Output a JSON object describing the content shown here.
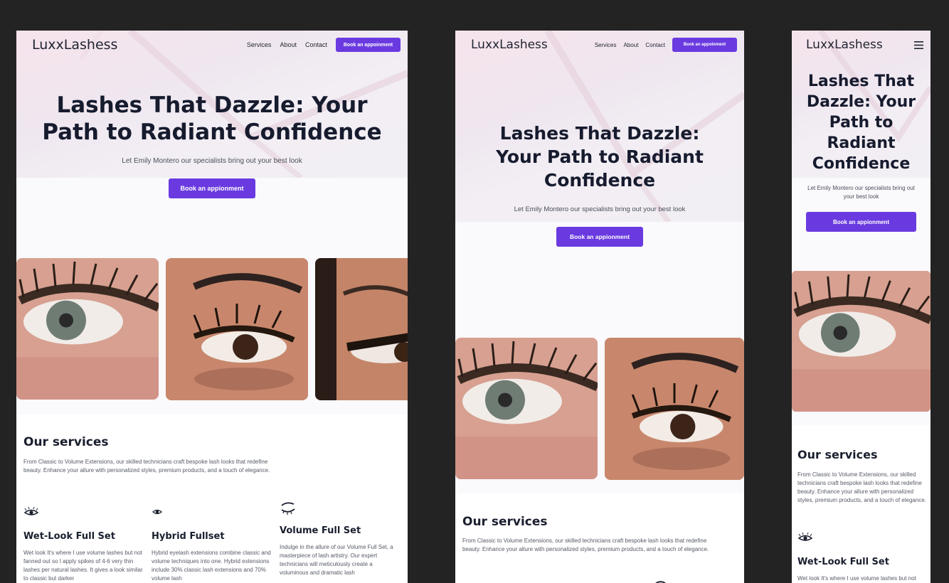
{
  "brand": "LuxxLashess",
  "nav": {
    "services": "Services",
    "about": "About",
    "contact": "Contact",
    "cta": "Book an appoinment"
  },
  "hero": {
    "title": "Lashes That Dazzle: Your Path to Radiant Confidence",
    "subtitle": "Let Emily Montero  our specialists bring out your best look",
    "cta": "Book an appionment"
  },
  "services": {
    "title": "Our services",
    "desc": "From Classic to Volume Extensions, our skilled technicians craft bespoke lash looks that redefine beauty. Enhance your allure with personalized styles, premium products, and a touch of elegance.",
    "items": [
      {
        "name": "Wet-Look Full Set",
        "icon": "eye-lash-icon",
        "desc": "Wet look It's where I use volume lashes but not fanned out so I apply spikes of 4-6 very thin lashes per natural lashes. It gives a look similar to classic but darker"
      },
      {
        "name": "Hybrid Fullset",
        "icon": "eye-small-icon",
        "desc": "Hybrid eyelash extensions combine classic and volume techniques into one. Hybrid extensions include 30% classic lash extensions and 70% volume lash"
      },
      {
        "name": "Volume Full Set",
        "icon": "closed-eye-icon",
        "desc": "Indulge in the allure of our Volume Full Set, a masterpiece of lash artistry. Our expert technicians will meticulously create a voluminous and dramatic lash"
      }
    ]
  },
  "photos": [
    "eye-photo-green",
    "eye-photo-brown",
    "eye-photo-side"
  ],
  "colors": {
    "accent": "#6a3ae0",
    "canvas": "#232323",
    "text": "#1f2330"
  }
}
